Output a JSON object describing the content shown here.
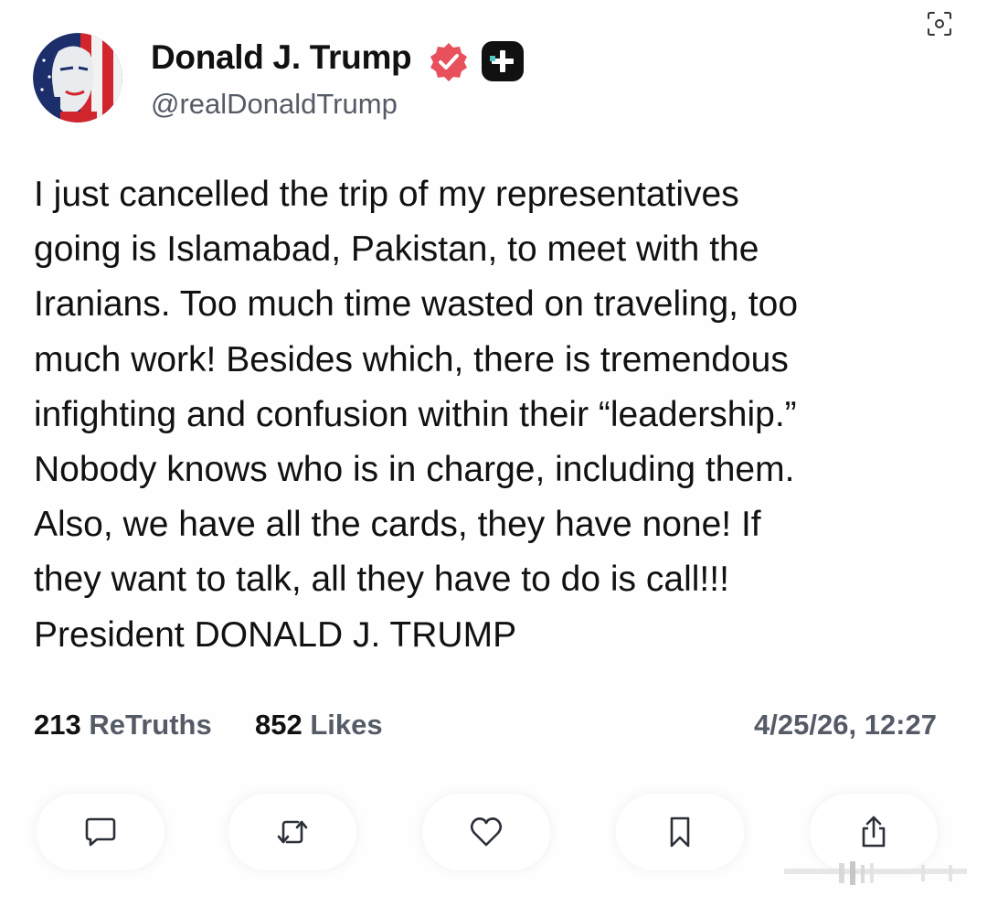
{
  "author": {
    "display_name": "Donald J. Trump",
    "handle": "@realDonaldTrump"
  },
  "post": {
    "lines": [
      "I just cancelled the trip of my representatives",
      "going is Islamabad, Pakistan, to meet with the",
      "Iranians. Too much time wasted on traveling, too",
      "much work! Besides which, there is tremendous",
      "infighting and confusion within their “leadership.”",
      "Nobody knows who is in charge, including them.",
      "Also, we have all the cards, they have none! If",
      "they want to talk, all they have to do is call!!!",
      "President DONALD J. TRUMP"
    ]
  },
  "stats": {
    "retruths_count": "213",
    "retruths_label": "ReTruths",
    "likes_count": "852",
    "likes_label": "Likes",
    "timestamp": "4/25/26, 12:27"
  },
  "icons": {
    "corner": "lens-scan-icon",
    "verified": "verified-badge-icon",
    "plus": "plus-badge-icon",
    "reply": "comment-icon",
    "retruth": "retruth-icon",
    "like": "heart-icon",
    "bookmark": "bookmark-icon",
    "share": "share-icon"
  },
  "colors": {
    "verified_badge": "#e8505b",
    "plus_badge": "#111111",
    "secondary_text": "#555b66"
  }
}
